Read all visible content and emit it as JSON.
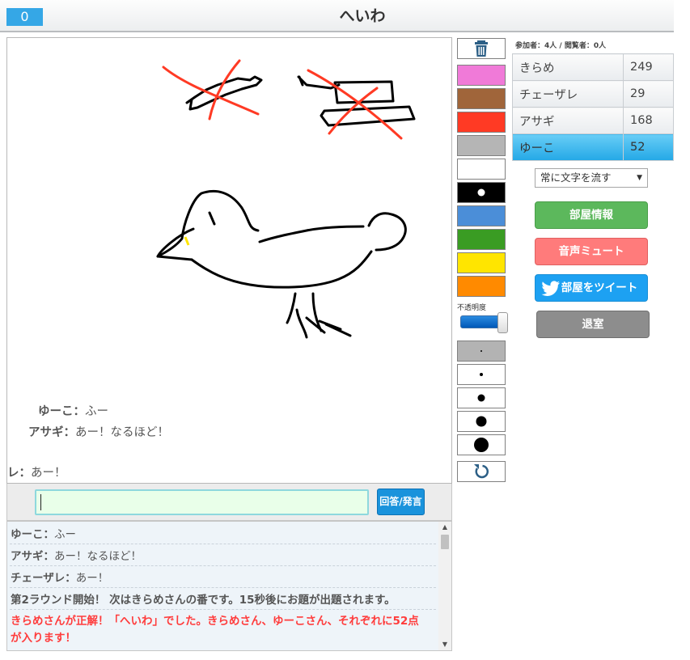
{
  "header": {
    "score": "0",
    "title": "へいわ"
  },
  "canvas": {
    "overlay_messages": [
      {
        "name": "ゆーこ",
        "text": "ふー"
      },
      {
        "name": "アサギ",
        "text": "あー！なるほど！"
      },
      {
        "name": "レ",
        "text": "あー！"
      }
    ]
  },
  "input": {
    "value": "",
    "send_label": "回答/発言"
  },
  "chat": {
    "lines": [
      {
        "type": "user",
        "name": "ゆーこ",
        "text": "ふー"
      },
      {
        "type": "user",
        "name": "アサギ",
        "text": "あー！なるほど！"
      },
      {
        "type": "user",
        "name": "チェーザレ",
        "text": "あー！"
      },
      {
        "type": "system",
        "text": "第2ラウンド開始！ 次はきらめさんの番です。15秒後にお題が出題されます。"
      },
      {
        "type": "correct",
        "text1": "きらめさんが正解！「へいわ」でした。きらめさん、ゆーこさん、それぞれに52点",
        "text2": "が入ります！"
      }
    ]
  },
  "tools": {
    "trash_icon": "trash-icon",
    "colors": [
      {
        "name": "pink",
        "hex": "#f07ad8"
      },
      {
        "name": "brown",
        "hex": "#a0653a"
      },
      {
        "name": "red",
        "hex": "#ff3a24"
      },
      {
        "name": "gray",
        "hex": "#b5b5b5"
      },
      {
        "name": "white",
        "hex": "#ffffff"
      },
      {
        "name": "black",
        "hex": "#000000"
      },
      {
        "name": "blue",
        "hex": "#4b8ed8"
      },
      {
        "name": "green",
        "hex": "#3a9c23"
      },
      {
        "name": "yellow",
        "hex": "#ffe500"
      },
      {
        "name": "orange",
        "hex": "#ff8a00"
      }
    ],
    "selected_color": "black",
    "opacity_label": "不透明度",
    "opacity_value": 1.0,
    "brush_sizes": [
      "xs",
      "s",
      "m",
      "l",
      "xl"
    ],
    "selected_size": "xs",
    "undo_icon": "undo-icon"
  },
  "sidebar": {
    "participants_text": "参加者：4人 / 閲覧者：0人",
    "players": [
      {
        "name": "きらめ",
        "score": "249",
        "active": false
      },
      {
        "name": "チェーザレ",
        "score": "29",
        "active": false
      },
      {
        "name": "アサギ",
        "score": "168",
        "active": false
      },
      {
        "name": "ゆーこ",
        "score": "52",
        "active": true
      }
    ],
    "select_value": "常に文字を流す",
    "buttons": {
      "room_info": "部屋情報",
      "mute": "音声ミュート",
      "tweet": "部屋をツイート",
      "leave": "退室"
    }
  },
  "accent_color": "#35a7e6"
}
